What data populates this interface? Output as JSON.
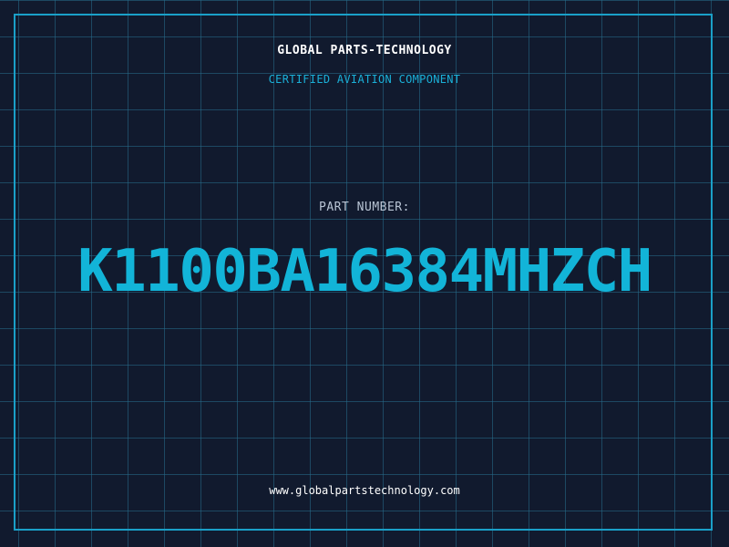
{
  "header": {
    "company_name": "GLOBAL PARTS-TECHNOLOGY",
    "subtitle": "CERTIFIED AVIATION COMPONENT"
  },
  "part": {
    "label": "PART NUMBER:",
    "number": "K1100BA16384MHZCH"
  },
  "footer": {
    "website": "www.globalpartstechnology.com"
  },
  "colors": {
    "background": "#111a2e",
    "grid": "#266e8c",
    "frame": "#1aa0c8",
    "accent": "#12b4d8",
    "label": "#b8c4d4",
    "text": "#ffffff"
  }
}
